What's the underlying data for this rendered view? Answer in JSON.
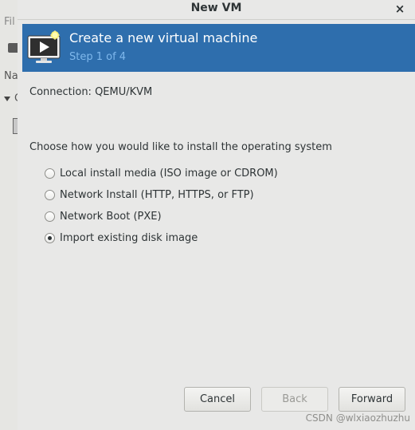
{
  "background_window": {
    "filter_label": "Fil",
    "name_column": "Na",
    "group_label": "C"
  },
  "dialog": {
    "title": "New VM",
    "close_glyph": "×"
  },
  "header": {
    "title": "Create a new virtual machine",
    "step": "Step 1 of 4",
    "icon": "monitor-play-icon",
    "background_color": "#2e6ead"
  },
  "connection": {
    "text": "Connection:  QEMU/KVM"
  },
  "install": {
    "question": "Choose how you would like to install the operating system",
    "options": [
      {
        "label": "Local install media (ISO image or CDROM)",
        "checked": false
      },
      {
        "label": "Network Install (HTTP, HTTPS, or FTP)",
        "checked": false
      },
      {
        "label": "Network Boot (PXE)",
        "checked": false
      },
      {
        "label": "Import existing disk image",
        "checked": true
      }
    ]
  },
  "buttons": {
    "cancel": "Cancel",
    "back": "Back",
    "forward": "Forward"
  },
  "watermark": "CSDN @wlxiaozhuzhu"
}
